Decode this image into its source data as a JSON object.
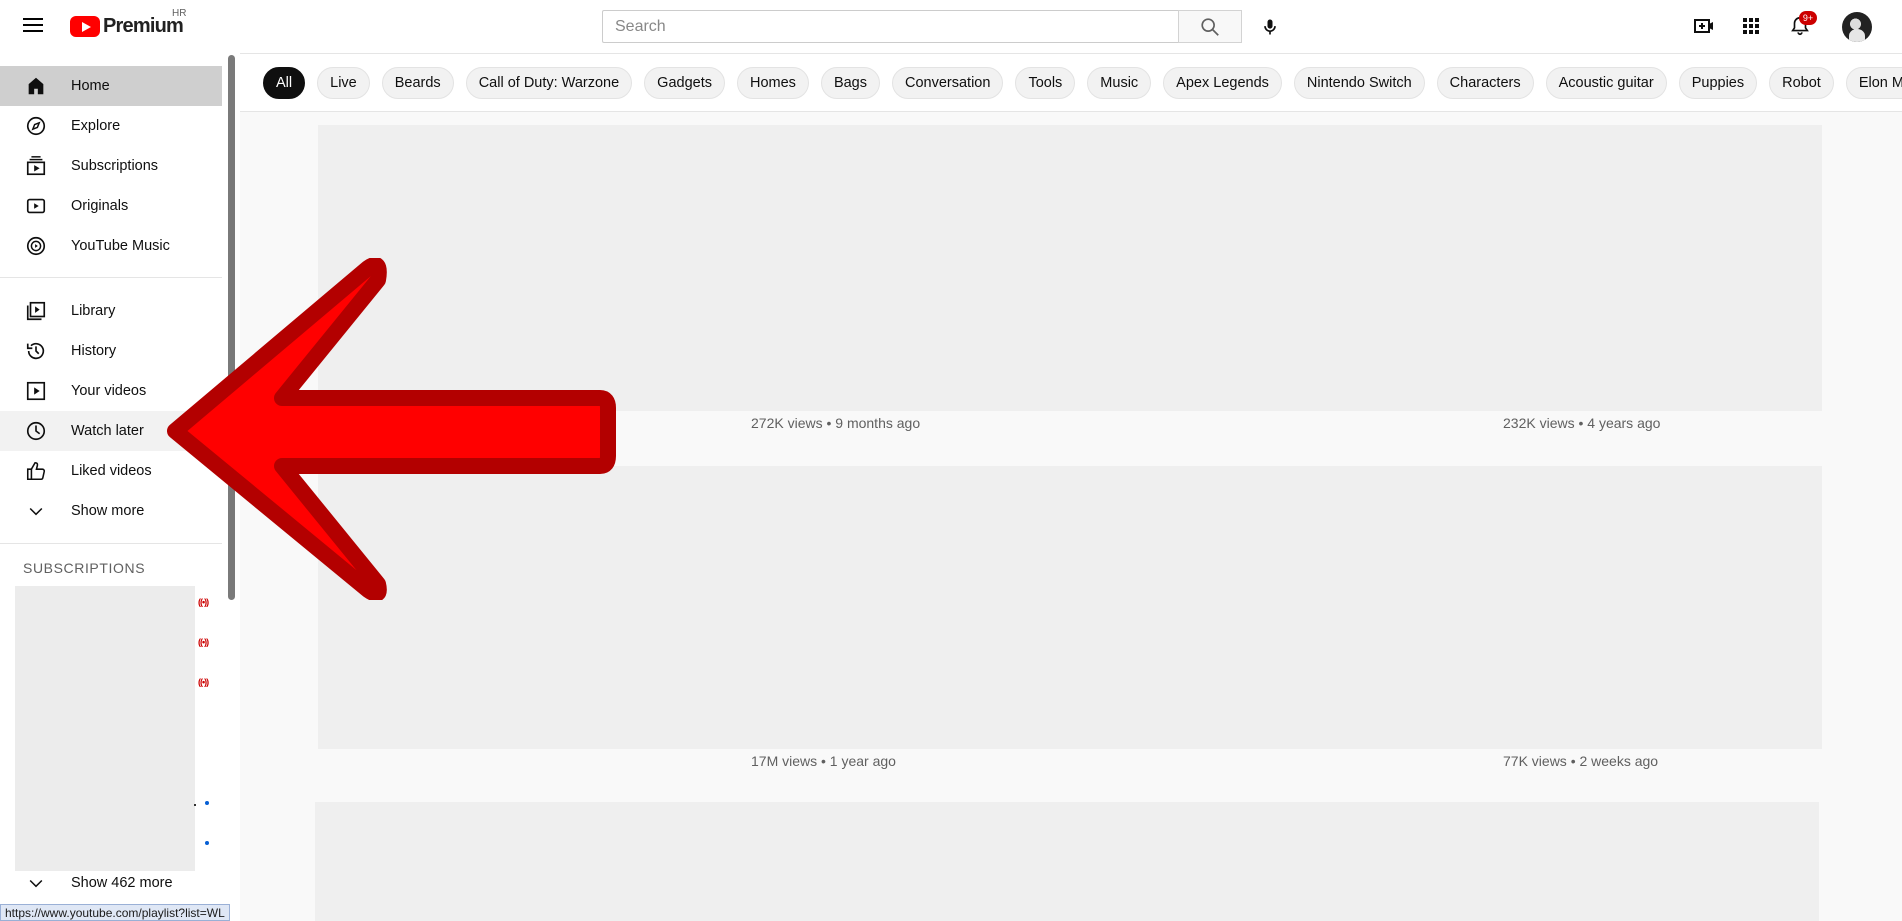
{
  "header": {
    "menu_icon": "hamburger-menu-icon",
    "logo_text": "Premium",
    "country_code": "HR",
    "search_placeholder": "Search",
    "notification_badge": "9+",
    "icons": [
      "create-video-icon",
      "apps-grid-icon",
      "notifications-bell-icon",
      "microphone-icon",
      "search-icon"
    ]
  },
  "sidebar": {
    "primary": [
      {
        "label": "Home",
        "icon": "home-icon"
      },
      {
        "label": "Explore",
        "icon": "compass-icon"
      },
      {
        "label": "Subscriptions",
        "icon": "subscriptions-icon"
      },
      {
        "label": "Originals",
        "icon": "originals-play-icon"
      },
      {
        "label": "YouTube Music",
        "icon": "music-disc-icon"
      }
    ],
    "library": [
      {
        "label": "Library",
        "icon": "library-icon"
      },
      {
        "label": "History",
        "icon": "history-icon"
      },
      {
        "label": "Your videos",
        "icon": "your-videos-icon"
      },
      {
        "label": "Watch later",
        "icon": "clock-icon"
      },
      {
        "label": "Liked videos",
        "icon": "thumbs-up-icon"
      },
      {
        "label": "Show more",
        "icon": "chevron-down-icon"
      }
    ],
    "subscriptions_title": "SUBSCRIPTIONS",
    "live_indicator": "((•))",
    "show_more_subs": "Show 462 more",
    "status_url": "https://www.youtube.com/playlist?list=WL"
  },
  "chips": [
    "All",
    "Live",
    "Beards",
    "Call of Duty: Warzone",
    "Gadgets",
    "Homes",
    "Bags",
    "Conversation",
    "Tools",
    "Music",
    "Apex Legends",
    "Nintendo Switch",
    "Characters",
    "Acoustic guitar",
    "Puppies",
    "Robot",
    "Elon Musk"
  ],
  "videos": [
    {
      "meta": "272K views • 9 months ago"
    },
    {
      "meta": "232K views • 4 years ago"
    },
    {
      "meta": "17M views • 1 year ago"
    },
    {
      "meta": "77K views • 2 weeks ago"
    }
  ],
  "colors": {
    "brand_red": "#ff0000",
    "arrow_fill": "#ff0000",
    "arrow_outline": "#b30000",
    "selected_chip": "#0f0f0f",
    "active_nav": "#cfcfcf"
  }
}
